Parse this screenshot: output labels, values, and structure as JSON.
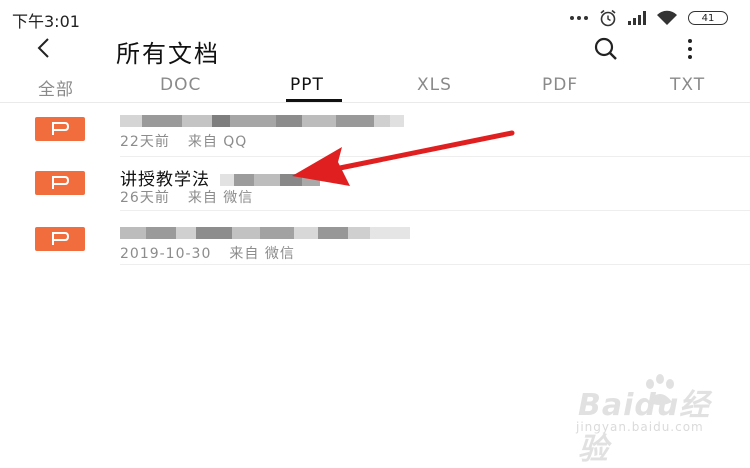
{
  "status_bar": {
    "time": "下午3:01",
    "battery": "41",
    "icons": [
      "more-dots-icon",
      "alarm-icon",
      "signal-icon",
      "wifi-icon",
      "battery-icon"
    ]
  },
  "header": {
    "title": "所有文档",
    "back_icon": "back-arrow-icon",
    "search_icon": "search-icon",
    "more_icon": "more-vertical-icon"
  },
  "tabs": [
    {
      "label": "全部",
      "active": false
    },
    {
      "label": "DOC",
      "active": false
    },
    {
      "label": "PPT",
      "active": true
    },
    {
      "label": "XLS",
      "active": false
    },
    {
      "label": "PDF",
      "active": false
    },
    {
      "label": "TXT",
      "active": false
    }
  ],
  "files": [
    {
      "type_icon": "P",
      "name": "",
      "name_obscured": true,
      "time": "22天前",
      "source": "来自 QQ"
    },
    {
      "type_icon": "P",
      "name": "讲授教学法",
      "name_obscured": false,
      "time": "26天前",
      "source": "来自 微信"
    },
    {
      "type_icon": "P",
      "name": "",
      "name_obscured": true,
      "time": "2019-10-30",
      "source": "来自 微信"
    }
  ],
  "colors": {
    "file_icon": "#f26d3d",
    "arrow": "#e02020",
    "active_tab": "#111111",
    "muted_text": "#8c8c8c"
  },
  "watermark": {
    "brand": "Baidu经验",
    "url": "jingyan.baidu.com"
  }
}
